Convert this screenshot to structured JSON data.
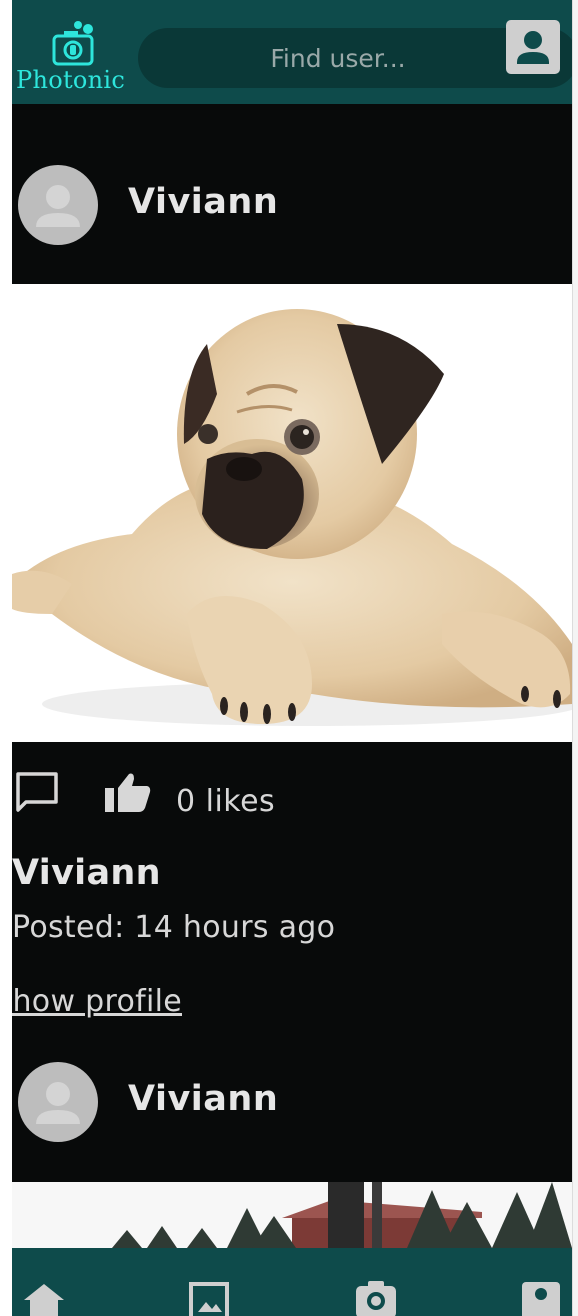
{
  "app": {
    "brand": "Photonic",
    "search_placeholder": "Find user..."
  },
  "icons": {
    "logo": "camera-logo-icon",
    "account": "account-box-icon",
    "comment": "comment-icon",
    "like": "thumb-up-icon",
    "avatar": "person-placeholder-icon",
    "nav": [
      "home-icon",
      "gallery-icon",
      "camera-icon",
      "profile-icon"
    ]
  },
  "colors": {
    "header": "#0e4b4b",
    "accent": "#2ee6dc",
    "background": "#080a0a",
    "text": "#e6e6e6"
  },
  "posts": [
    {
      "username": "Viviann",
      "likes": "0 likes",
      "meta_username": "Viviann",
      "posted": "Posted: 14 hours ago",
      "profile_link": "Show profile"
    },
    {
      "username": "Viviann"
    }
  ]
}
